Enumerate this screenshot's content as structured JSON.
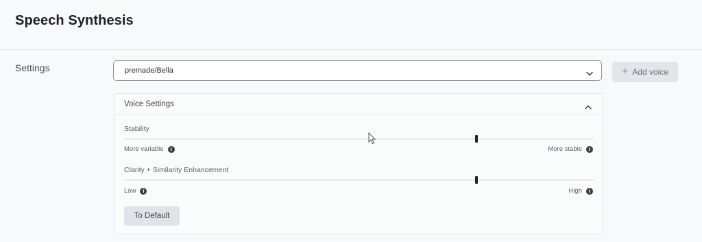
{
  "header": {
    "title": "Speech Synthesis"
  },
  "settings": {
    "label": "Settings",
    "voice_select": {
      "value": "premade/Bella"
    },
    "add_voice_label": "Add voice"
  },
  "voice_settings": {
    "title": "Voice Settings",
    "stability": {
      "label": "Stability",
      "value": 0.75,
      "min_hint": "More variable",
      "max_hint": "More stable"
    },
    "clarity": {
      "label": "Clarity + Similarity Enhancement",
      "value": 0.75,
      "min_hint": "Low",
      "max_hint": "High"
    },
    "reset_label": "To Default"
  },
  "icons": {
    "select_chevron": "chevron-down-icon",
    "panel_chevron": "chevron-up-icon",
    "add": "plus-icon",
    "info": "info-icon",
    "cursor": "mouse-cursor-icon"
  },
  "colors": {
    "text_primary": "#1f2233",
    "slider_thumb": "#1f2233",
    "button_bg": "#e2e3e7"
  }
}
